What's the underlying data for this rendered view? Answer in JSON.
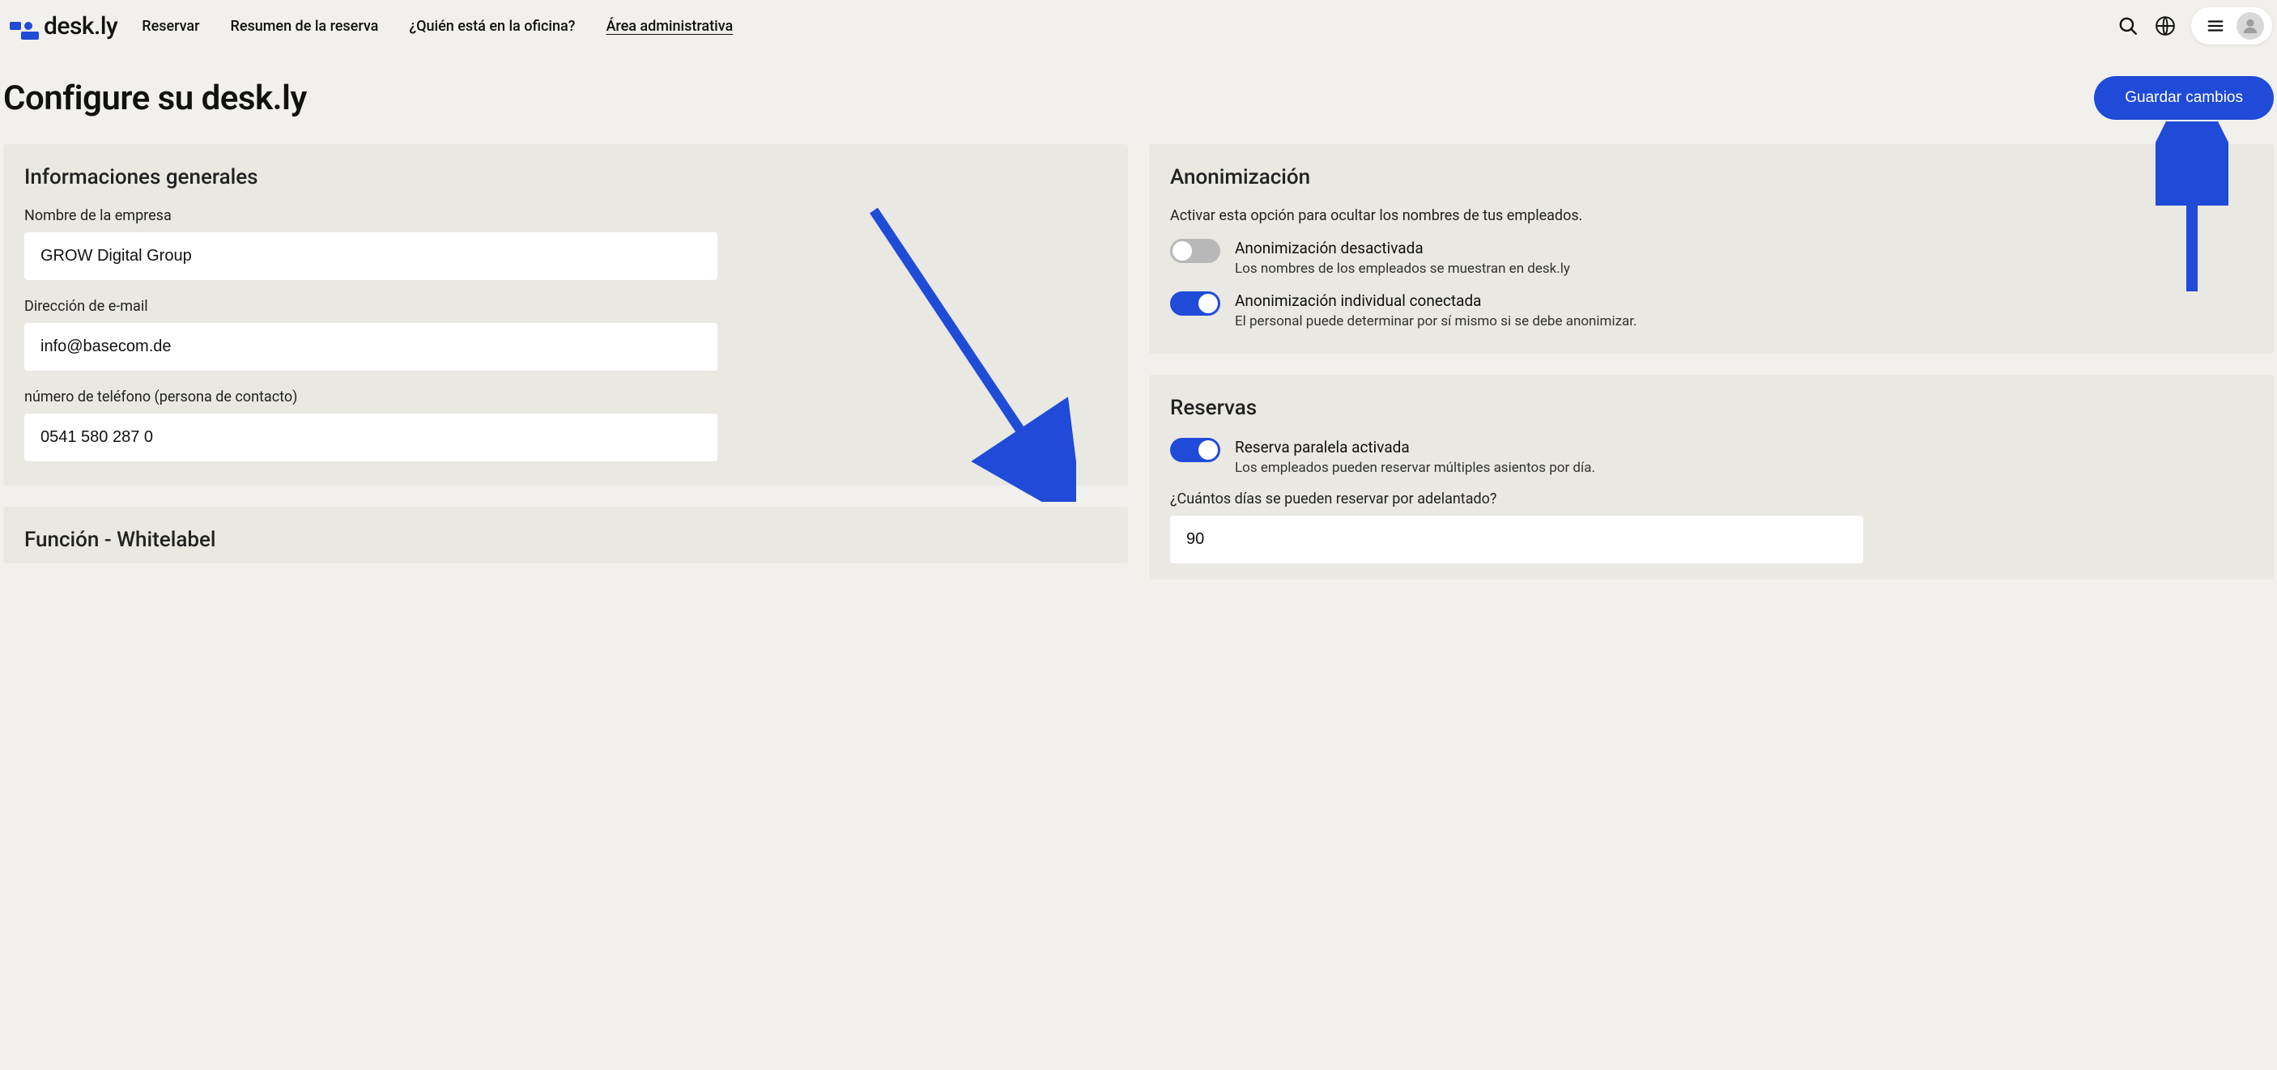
{
  "brand": {
    "name": "desk.ly"
  },
  "nav": {
    "items": [
      {
        "label": "Reservar",
        "active": false
      },
      {
        "label": "Resumen de la reserva",
        "active": false
      },
      {
        "label": "¿Quién está en la oficina?",
        "active": false
      },
      {
        "label": "Área administrativa",
        "active": true
      }
    ]
  },
  "page": {
    "title": "Configure su desk.ly",
    "save_label": "Guardar cambios"
  },
  "general": {
    "heading": "Informaciones generales",
    "company_label": "Nombre de la empresa",
    "company_value": "GROW Digital Group",
    "email_label": "Dirección de e-mail",
    "email_value": "info@basecom.de",
    "phone_label": "número de teléfono (persona de contacto)",
    "phone_value": "0541 580 287 0"
  },
  "whitelabel": {
    "heading": "Función - Whitelabel"
  },
  "anon": {
    "heading": "Anonimización",
    "helper": "Activar esta opción para ocultar los nombres de tus empleados.",
    "global": {
      "title": "Anonimización desactivada",
      "sub": "Los nombres de los empleados se muestran en desk.ly",
      "on": false
    },
    "individual": {
      "title": "Anonimización individual conectada",
      "sub": "El personal puede determinar por sí mismo si se debe anonimizar.",
      "on": true
    }
  },
  "booking": {
    "heading": "Reservas",
    "parallel": {
      "title": "Reserva paralela activada",
      "sub": "Los empleados pueden reservar múltiples asientos por día.",
      "on": true
    },
    "days_label": "¿Cuántos días se pueden reservar por adelantado?",
    "days_value": "90"
  },
  "colors": {
    "accent": "#1f4bd8"
  }
}
